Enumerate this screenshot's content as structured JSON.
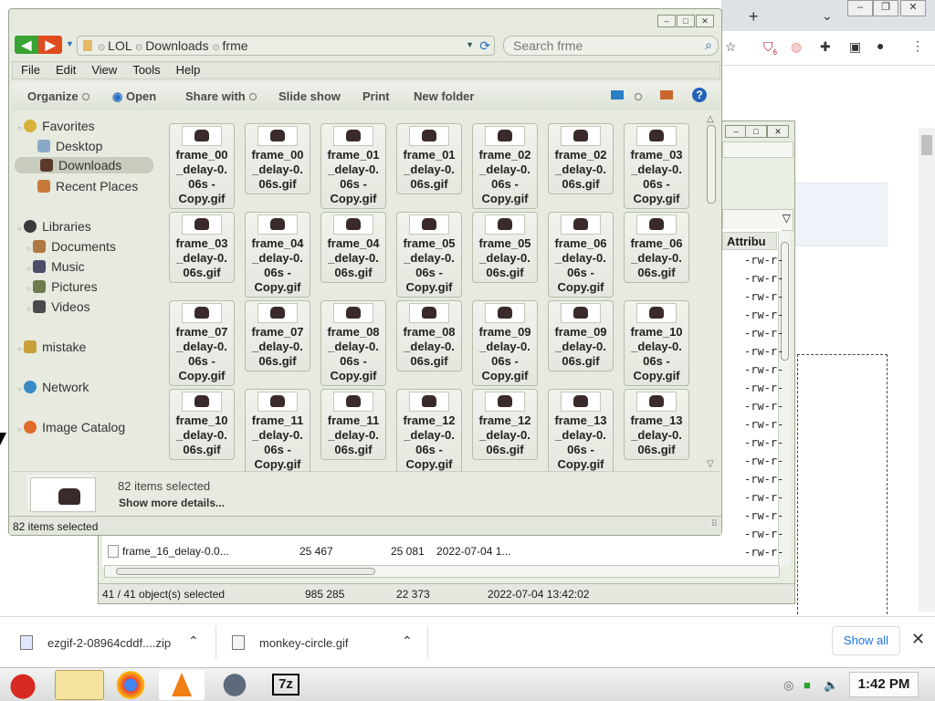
{
  "main_window": {
    "breadcrumb": [
      "LOL",
      "Downloads",
      "frme"
    ],
    "search_placeholder": "Search frme",
    "menu": [
      "File",
      "Edit",
      "View",
      "Tools",
      "Help"
    ],
    "commands": {
      "organize": "Organize",
      "open": "Open",
      "share": "Share with",
      "slideshow": "Slide show",
      "print": "Print",
      "new_folder": "New folder"
    },
    "sidebar": {
      "favorites": "Favorites",
      "desktop": "Desktop",
      "downloads": "Downloads",
      "recent": "Recent Places",
      "libraries": "Libraries",
      "documents": "Documents",
      "music": "Music",
      "pictures": "Pictures",
      "videos": "Videos",
      "mistake": "mistake",
      "network": "Network",
      "image_catalog": "Image Catalog"
    },
    "files": [
      "frame_00 _delay-0. 06s - Copy.gif",
      "frame_00 _delay-0. 06s.gif",
      "frame_01 _delay-0. 06s - Copy.gif",
      "frame_01 _delay-0. 06s.gif",
      "frame_02 _delay-0. 06s - Copy.gif",
      "frame_02 _delay-0. 06s.gif",
      "frame_03 _delay-0. 06s - Copy.gif",
      "frame_03 _delay-0. 06s.gif",
      "frame_04 _delay-0. 06s - Copy.gif",
      "frame_04 _delay-0. 06s.gif",
      "frame_05 _delay-0. 06s - Copy.gif",
      "frame_05 _delay-0. 06s.gif",
      "frame_06 _delay-0. 06s - Copy.gif",
      "frame_06 _delay-0. 06s.gif",
      "frame_07 _delay-0. 06s - Copy.gif",
      "frame_07 _delay-0. 06s.gif",
      "frame_08 _delay-0. 06s - Copy.gif",
      "frame_08 _delay-0. 06s.gif",
      "frame_09 _delay-0. 06s - Copy.gif",
      "frame_09 _delay-0. 06s.gif",
      "frame_10 _delay-0. 06s - Copy.gif",
      "frame_10 _delay-0. 06s.gif",
      "frame_11 _delay-0. 06s - Copy.gif",
      "frame_11 _delay-0. 06s.gif",
      "frame_12 _delay-0. 06s - Copy.gif",
      "frame_12 _delay-0. 06s.gif",
      "frame_13 _delay-0. 06s - Copy.gif",
      "frame_13 _delay-0. 06s.gif"
    ],
    "details_count": "82 items selected",
    "details_more": "Show more details...",
    "status": "82 items selected"
  },
  "back_window": {
    "attr_header": "Attribu",
    "attr_values": [
      "-rw-r-",
      "-rw-r-",
      "-rw-r-",
      "-rw-r-",
      "-rw-r-",
      "-rw-r-",
      "-rw-r-",
      "-rw-r-",
      "-rw-r-",
      "-rw-r-",
      "-rw-r-",
      "-rw-r-",
      "-rw-r-",
      "-rw-r-",
      "-rw-r-",
      "-rw-r-",
      "-rw-r-"
    ],
    "row": {
      "name": "frame_16_delay-0.0...",
      "size": "25 467",
      "packed": "25 081",
      "modified": "2022-07-04 1..."
    },
    "status": {
      "selected": "41 / 41 object(s) selected",
      "size": "985 285",
      "packed": "22 373",
      "date": "2022-07-04 13:42:02"
    }
  },
  "downloads_bar": {
    "items": [
      {
        "name": "ezgif-2-08964cddf....zip"
      },
      {
        "name": "monkey-circle.gif"
      }
    ],
    "show_all": "Show all"
  },
  "taskbar": {
    "clock": "1:42 PM"
  },
  "chrome": {
    "extension_badge": "6"
  }
}
